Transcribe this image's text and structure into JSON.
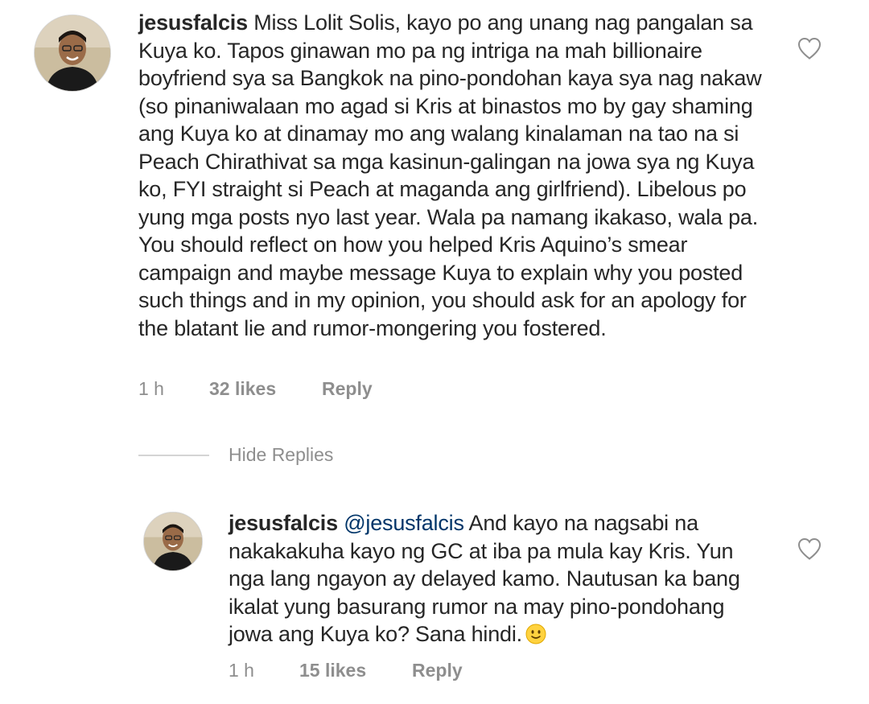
{
  "comments": [
    {
      "username": "jesusfalcis",
      "mention": "",
      "body": " Miss Lolit Solis, kayo po ang unang nag pangalan sa Kuya ko. Tapos ginawan mo pa ng intriga na mah billionaire boyfriend sya sa Bangkok na pino-pondohan kaya sya nag nakaw (so pinaniwalaan mo agad si Kris at binastos mo by gay shaming ang Kuya ko at dinamay mo ang walang kinalaman na tao na si Peach Chirathivat sa mga kasinun-galingan na jowa sya ng Kuya ko, FYI straight si Peach at maganda ang girlfriend). Libelous po yung mga posts nyo last year. Wala pa namang ikakaso, wala pa. You should reflect on how you helped Kris Aquino’s smear campaign and maybe message Kuya to explain why you posted such things and in my opinion, you should ask for an apology for the blatant lie and rumor-mongering you fostered.",
      "time": "1 h",
      "likes": "32 likes",
      "reply": "Reply"
    },
    {
      "username": "jesusfalcis",
      "mention": " @jesusfalcis",
      "body": " And kayo na nagsabi na nakakakuha kayo ng GC at iba pa mula kay Kris. Yun nga lang ngayon ay delayed kamo. Nautusan ka bang ikalat yung basurang rumor na may pino-pondohang jowa ang Kuya ko? Sana hindi.",
      "time": "1 h",
      "likes": "15 likes",
      "reply": "Reply"
    }
  ],
  "hide_replies": "Hide Replies",
  "icons": {
    "like": "heart-outline-icon",
    "emoji": "slightly-smiling-face-emoji"
  },
  "colors": {
    "text": "#262626",
    "muted": "#8e8e8e",
    "mention": "#003569"
  }
}
